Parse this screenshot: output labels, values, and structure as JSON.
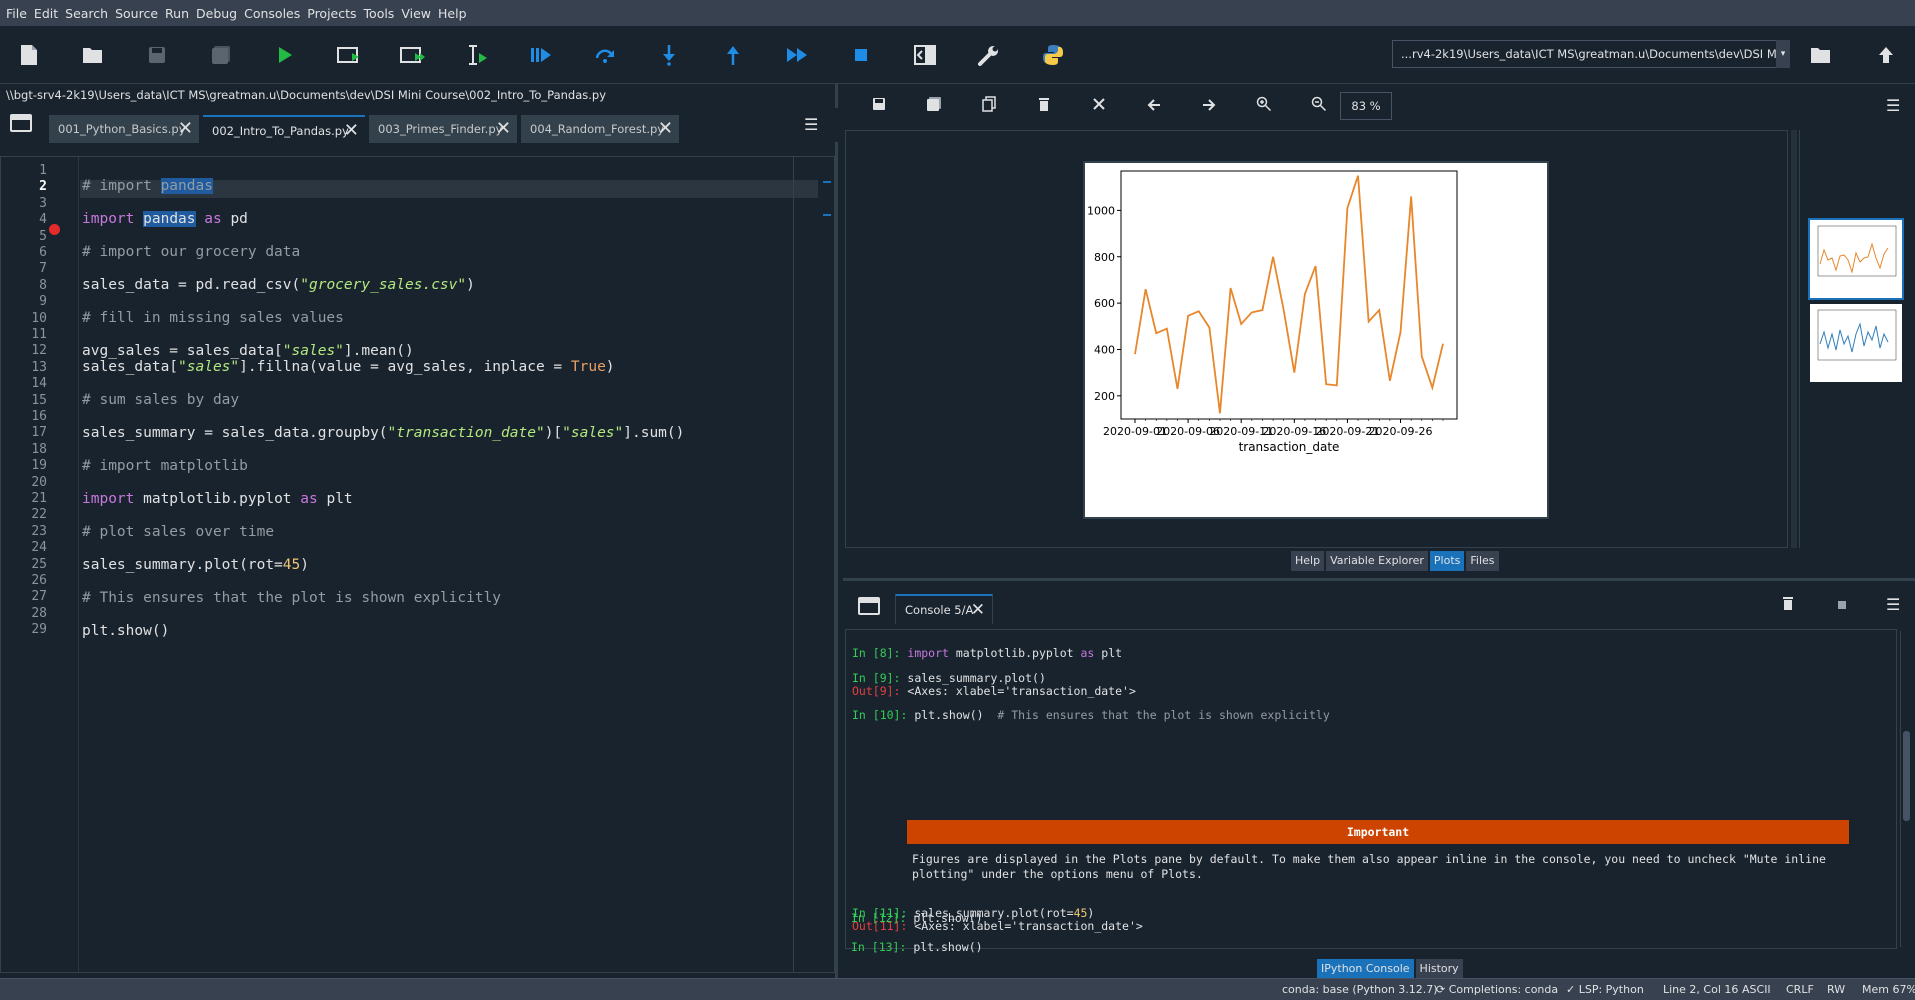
{
  "menu": [
    "File",
    "Edit",
    "Search",
    "Source",
    "Run",
    "Debug",
    "Consoles",
    "Projects",
    "Tools",
    "View",
    "Help"
  ],
  "toolbar": {
    "working_dir": "...rv4-2k19\\Users_data\\ICT MS\\greatman.u\\Documents\\dev\\DSI Mini Course"
  },
  "editor": {
    "file_path": "\\\\bgt-srv4-2k19\\Users_data\\ICT MS\\greatman.u\\Documents\\dev\\DSI Mini Course\\002_Intro_To_Pandas.py",
    "tabs": [
      {
        "label": "001_Python_Basics.py"
      },
      {
        "label": "002_Intro_To_Pandas.py"
      },
      {
        "label": "003_Primes_Finder.py"
      },
      {
        "label": "004_Random_Forest.py"
      }
    ],
    "line_numbers": [
      "1",
      "2",
      "3",
      "4",
      "5",
      "6",
      "7",
      "8",
      "9",
      "10",
      "11",
      "12",
      "13",
      "14",
      "15",
      "16",
      "17",
      "18",
      "19",
      "20",
      "21",
      "22",
      "23",
      "24",
      "25",
      "26",
      "27",
      "28",
      "29"
    ],
    "code": {
      "l2_a": "# import ",
      "l2_b": "pandas",
      "l4_a": "import",
      "l4_b": "pandas",
      "l4_c": "as",
      "l4_d": " pd",
      "l6": "# import our grocery data",
      "l8_a": "sales_data = pd.read_csv(",
      "l8_b": "\"grocery_sales.csv\"",
      "l8_c": ")",
      "l10": "# fill in missing sales values",
      "l12_a": "avg_sales = sales_data[",
      "l12_b": "\"sales\"",
      "l12_c": "].mean()",
      "l13_a": "sales_data[",
      "l13_b": "\"sales\"",
      "l13_c": "].fillna(value = avg_sales, inplace = ",
      "l13_d": "True",
      "l13_e": ")",
      "l15": "# sum sales by day",
      "l17_a": "sales_summary = sales_data.groupby(",
      "l17_b": "\"transaction_date\"",
      "l17_c": ")[",
      "l17_d": "\"sales\"",
      "l17_e": "].sum()",
      "l19": "# import matplotlib",
      "l21_a": "import",
      "l21_b": " matplotlib.pyplot ",
      "l21_c": "as",
      "l21_d": " plt",
      "l23": "# plot sales over time",
      "l25_a": "sales_summary.plot(rot=",
      "l25_b": "45",
      "l25_c": ")",
      "l27": "# This ensures that the plot is shown explicitly",
      "l29": "plt.show()"
    }
  },
  "plots": {
    "zoom": "83 %",
    "pane_tabs": [
      "Help",
      "Variable Explorer",
      "Plots",
      "Files"
    ]
  },
  "chart_data": {
    "type": "line",
    "xlabel": "transaction_date",
    "x_tick_labels": [
      "2020-09-01",
      "2020-09-06",
      "2020-09-11",
      "2020-09-16",
      "2020-09-21",
      "2020-09-26"
    ],
    "y_tick_labels": [
      "200",
      "400",
      "600",
      "800",
      "1000"
    ],
    "ylim": [
      100,
      1170
    ],
    "series": [
      {
        "color": "#e8862a",
        "x": [
          "2020-09-01",
          "2020-09-02",
          "2020-09-03",
          "2020-09-04",
          "2020-09-05",
          "2020-09-06",
          "2020-09-07",
          "2020-09-08",
          "2020-09-09",
          "2020-09-10",
          "2020-09-11",
          "2020-09-12",
          "2020-09-13",
          "2020-09-14",
          "2020-09-15",
          "2020-09-16",
          "2020-09-17",
          "2020-09-18",
          "2020-09-19",
          "2020-09-20",
          "2020-09-21",
          "2020-09-22",
          "2020-09-23",
          "2020-09-24",
          "2020-09-25",
          "2020-09-26",
          "2020-09-27",
          "2020-09-28",
          "2020-09-29",
          "2020-09-30"
        ],
        "values": [
          380,
          660,
          470,
          490,
          230,
          545,
          565,
          495,
          125,
          665,
          510,
          560,
          570,
          800,
          570,
          300,
          640,
          760,
          250,
          245,
          1010,
          1150,
          520,
          570,
          265,
          475,
          1060,
          370,
          235,
          425
        ]
      }
    ]
  },
  "console": {
    "tab_label": "Console 5/A",
    "lines": {
      "in8_p": "In [8]: ",
      "in8_a": "import",
      "in8_b": " matplotlib.pyplot ",
      "in8_c": "as",
      "in8_d": " plt",
      "in9_p": "In [9]: ",
      "in9_c": "sales_summary.plot()",
      "out9_p": "Out[9]: ",
      "out9_c": "<Axes: xlabel='transaction_date'>",
      "in10_p": "In [10]: ",
      "in10_c": "plt.show()  ",
      "in10_cm": "# This ensures that the plot is shown explicitly",
      "important_title": "Important",
      "important_text": "Figures are displayed in the Plots pane by default. To make them also appear inline in the console, you need to uncheck \"Mute inline plotting\" under the options menu of Plots.",
      "in11_p": "In [11]: ",
      "in11_a": "sales_summary.plot(rot=",
      "in11_b": "45",
      "in11_c": ")",
      "out11_p": "Out[11]: ",
      "out11_c": "<Axes: xlabel='transaction_date'>",
      "in12_p": "In [12]: ",
      "in12_c": "plt.show()",
      "in13_p": "In [13]: ",
      "in13_c": "plt.show()"
    },
    "bottom_tabs": [
      "IPython Console",
      "History"
    ]
  },
  "status": {
    "conda": "conda: base (Python 3.12.7)",
    "completions": "Completions: conda",
    "lsp": "LSP: Python",
    "position": "Line 2, Col 16",
    "encoding": "ASCII",
    "eol": "CRLF",
    "rw": "RW",
    "mem": "Mem 67%"
  }
}
